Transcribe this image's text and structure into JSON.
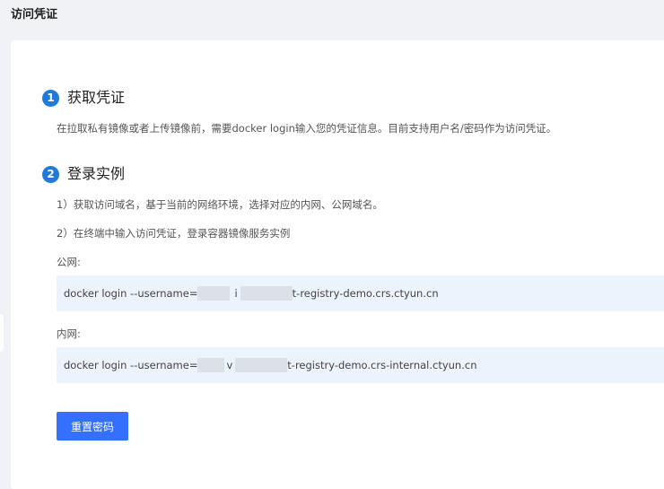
{
  "page": {
    "title": "访问凭证"
  },
  "steps": [
    {
      "number": "1",
      "title": "获取凭证"
    },
    {
      "number": "2",
      "title": "登录实例"
    }
  ],
  "step1": {
    "description": "在拉取私有镜像或者上传镜像前，需要docker login输入您的凭证信息。目前支持用户名/密码作为访问凭证。"
  },
  "step2": {
    "instructions": [
      "1）获取访问域名，基于当前的网络环境，选择对应的内网、公网域名。",
      "2）在终端中输入访问凭证，登录容器镜像服务实例"
    ],
    "public": {
      "label": "公网:",
      "cmd_prefix": "docker login --username=",
      "cmd_mid": "i",
      "cmd_suffix": "t-registry-demo.crs.ctyun.cn"
    },
    "internal": {
      "label": "内网:",
      "cmd_prefix": "docker login --username=",
      "cmd_mid": "v",
      "cmd_suffix": "t-registry-demo.crs-internal.ctyun.cn"
    }
  },
  "actions": {
    "reset_password": "重置密码"
  },
  "colors": {
    "accent": "#1f7ad9",
    "button": "#3370ff",
    "cmd_bg": "#ebf3fd"
  }
}
